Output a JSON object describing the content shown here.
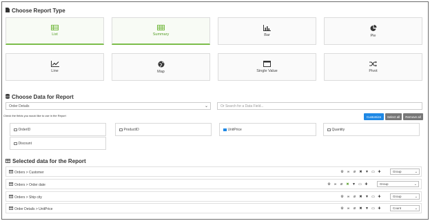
{
  "report_type": {
    "title": "Choose Report Type",
    "cards": [
      {
        "label": "List",
        "icon": "table-icon",
        "selected": true
      },
      {
        "label": "Summary",
        "icon": "grid-table-icon",
        "selected": true
      },
      {
        "label": "Bar",
        "icon": "bar-chart-icon",
        "selected": false
      },
      {
        "label": "Pie",
        "icon": "pie-chart-icon",
        "selected": false
      },
      {
        "label": "Line",
        "icon": "line-chart-icon",
        "selected": false
      },
      {
        "label": "Map",
        "icon": "globe-icon",
        "selected": false
      },
      {
        "label": "Single Value",
        "icon": "window-icon",
        "selected": false
      },
      {
        "label": "Pivot",
        "icon": "shuffle-icon",
        "selected": false
      }
    ]
  },
  "data_section": {
    "title": "Choose Data for Report",
    "source_value": "Order Details",
    "search_placeholder": "Or Search for a Data Field...",
    "hint": "Check the fields you would like to use in the Report",
    "buttons": {
      "customize": "Customize",
      "select_all": "Select all",
      "remove_all": "Remove all"
    },
    "fields": [
      {
        "label": "OrderID",
        "checked": false
      },
      {
        "label": "ProductID",
        "checked": false
      },
      {
        "label": "UnitPrice",
        "checked": true
      },
      {
        "label": "Quantity",
        "checked": false
      },
      {
        "label": "Discount",
        "checked": false
      }
    ]
  },
  "selected_section": {
    "title": "Selected data for the Report",
    "rows": [
      {
        "label": "Orders > Customer",
        "aggregate": "Group"
      },
      {
        "label": "Orders > Order date",
        "aggregate": "Group"
      },
      {
        "label": "Orders > Ship city",
        "aggregate": "Group"
      },
      {
        "label": "Order Details > UnitPrice",
        "aggregate": "Count"
      }
    ]
  },
  "colors": {
    "accent": "#1e88e5",
    "selected_green": "#7cbd4a"
  }
}
